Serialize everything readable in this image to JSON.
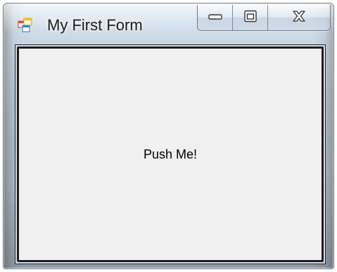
{
  "window": {
    "title": "My First Form",
    "icon": "windows-forms-app-icon",
    "caption_buttons": {
      "minimize_icon": "minimize-icon",
      "maximize_icon": "maximize-icon",
      "close_icon": "close-icon"
    }
  },
  "form": {
    "button_label": "Push Me!"
  },
  "colors": {
    "button_face": "#f0f0f0",
    "button_border": "#1e1e1e",
    "title_text": "#1a1a1a"
  }
}
